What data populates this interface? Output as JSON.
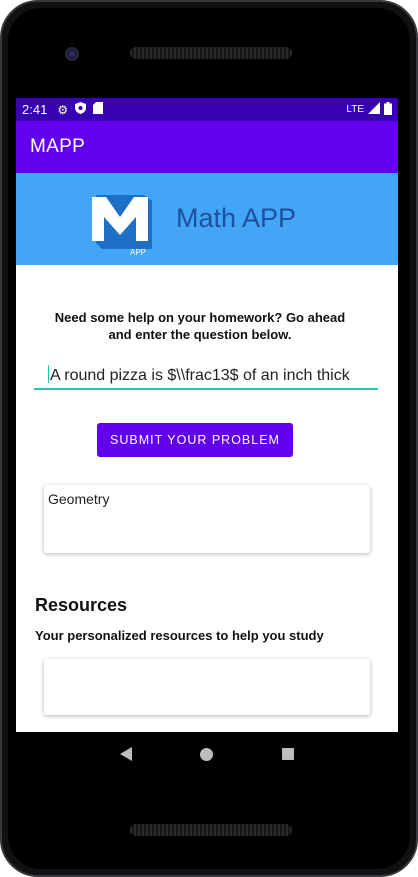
{
  "status_bar": {
    "time": "2:41",
    "network": "LTE",
    "icons": [
      "gear-icon",
      "shield-icon",
      "sd-card-icon",
      "signal-icon",
      "battery-icon"
    ]
  },
  "app_bar": {
    "title": "MAPP"
  },
  "hero": {
    "title": "Math APP",
    "logo_text": "APP"
  },
  "main": {
    "prompt": "Need some help on your homework? Go ahead and enter the question below.",
    "question_value": "A round pizza is $\\\\frac13$ of an inch thick",
    "submit_label": "SUBMIT YOUR PROBLEM",
    "category": "Geometry"
  },
  "resources": {
    "title": "Resources",
    "subtitle": "Your personalized resources to help you study"
  },
  "colors": {
    "status_bar": "#3700b3",
    "primary": "#6200ee",
    "hero_bg": "#42a5f5",
    "accent": "#26c6b6"
  }
}
